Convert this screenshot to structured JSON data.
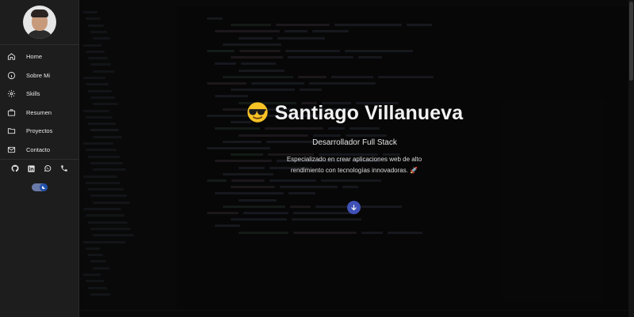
{
  "sidebar": {
    "avatar_alt": "",
    "items": [
      {
        "label": "Home",
        "icon": "home-icon"
      },
      {
        "label": "Sobre Mi",
        "icon": "info-icon"
      },
      {
        "label": "Skills",
        "icon": "gear-icon"
      },
      {
        "label": "Resumen",
        "icon": "briefcase-icon"
      },
      {
        "label": "Proyectos",
        "icon": "folder-icon"
      },
      {
        "label": "Contacto",
        "icon": "mail-icon"
      }
    ],
    "socials": [
      "github-icon",
      "linkedin-icon",
      "whatsapp-icon",
      "phone-icon"
    ],
    "theme_toggle": {
      "state": "dark",
      "icon": "moon-icon"
    }
  },
  "hero": {
    "emoji": "sunglasses-emoji",
    "name": "Santiago Villanueva",
    "role": "Desarrollador Full Stack",
    "description_line1": "Especializado en crear aplicaciones web de alto",
    "description_line2": "rendimiento con tecnologías innovadoras. 🚀",
    "scroll_button_icon": "arrow-down-icon"
  },
  "colors": {
    "sidebar_bg": "#1d1d1d",
    "page_bg": "#0b0b0b",
    "accent": "#3f51b5",
    "text": "#f2f2f2"
  }
}
